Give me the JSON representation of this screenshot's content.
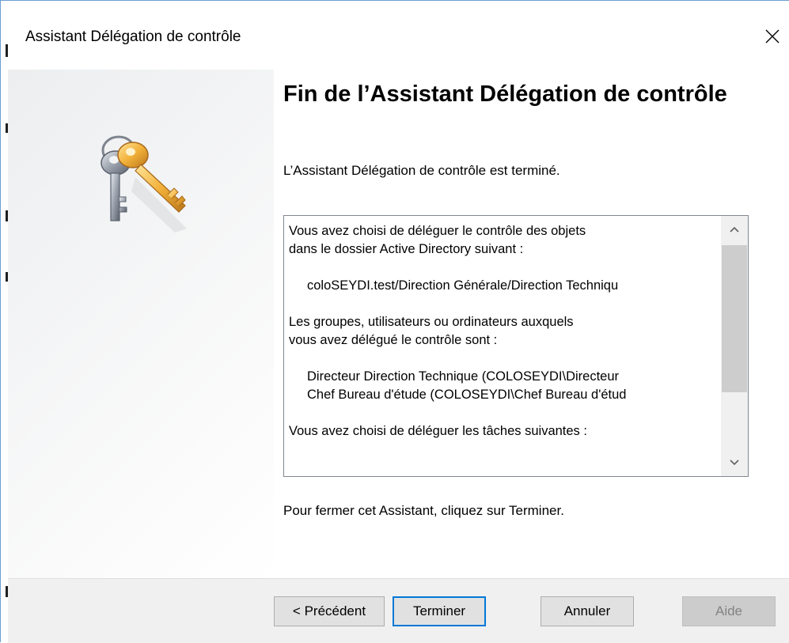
{
  "window": {
    "title": "Assistant Délégation de contrôle"
  },
  "page": {
    "heading": "Fin de l’Assistant Délégation de contrôle",
    "subtitle": "L’Assistant Délégation de contrôle est terminé.",
    "closing": "Pour fermer cet Assistant, cliquez sur Terminer."
  },
  "summary": {
    "lines": [
      "Vous avez choisi de déléguer le contrôle des objets",
      "dans le dossier Active Directory suivant :",
      "",
      "coloSEYDI.test/Direction Générale/Direction Techniqu",
      "",
      "Les groupes, utilisateurs ou ordinateurs auxquels",
      "vous avez délégué le contrôle sont :",
      "",
      "Directeur Direction Technique (COLOSEYDI\\Directeur",
      "Chef Bureau d'étude (COLOSEYDI\\Chef Bureau d'étud",
      "",
      "Vous avez choisi de déléguer les tâches suivantes :"
    ]
  },
  "buttons": {
    "back": "< Précédent",
    "finish": "Terminer",
    "cancel": "Annuler",
    "help": "Aide"
  },
  "icons": {
    "close": "close-icon",
    "keys": "keys-icon",
    "scroll_up": "chevron-up-icon",
    "scroll_down": "chevron-down-icon"
  },
  "colors": {
    "window_border": "#6d9ecf",
    "default_button_border": "#0078d7",
    "footer_bg": "#f0f0f0"
  }
}
